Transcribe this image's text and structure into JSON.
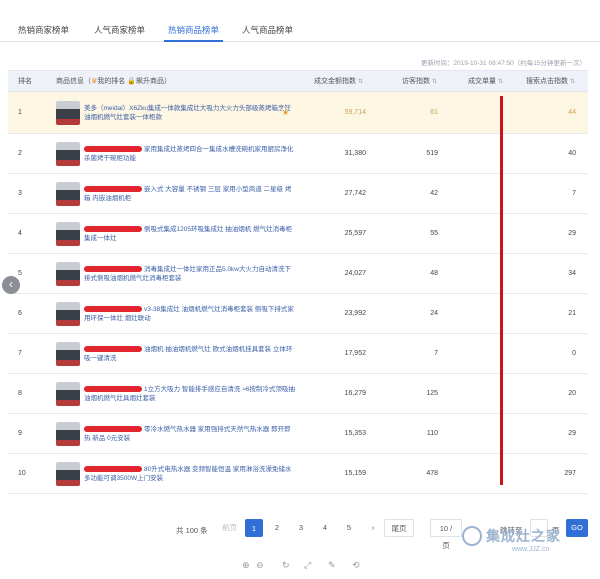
{
  "tabs": [
    {
      "label": "热销商家榜单",
      "active": false
    },
    {
      "label": "人气商家榜单",
      "active": false
    },
    {
      "label": "热销商品榜单",
      "active": true
    },
    {
      "label": "人气商品榜单",
      "active": false
    }
  ],
  "updated_text": "更新时间：2019-10-31 08:47:50（约每15分钟更新一次）",
  "columns": {
    "rank": "排名",
    "info_a": "商品信息（",
    "info_b": "我的排名",
    "info_c": "飙升商品）",
    "total": "成交金额指数",
    "visits": "访客指数",
    "sold": "成交单量",
    "search": "搜索点击指数",
    "sort_glyph": "⇅",
    "crown_glyph": "♛",
    "lock_glyph": "🔒"
  },
  "rows": [
    {
      "rank": "1",
      "name": "美多（meidal）X6Zku集成一体款集成灶大吸力大火力头部级蒸烤箱烹饪油烟机燃气灶套装一体柜款",
      "total": "59,714",
      "visits": "61",
      "search": "44",
      "highlight": true,
      "redacted": false
    },
    {
      "rank": "2",
      "name": "家用集成灶蒸烤四合一集成水槽洗碗机家用厨房净化杀菌烤干碗柜功能",
      "total": "31,380",
      "visits": "519",
      "search": "40",
      "highlight": false,
      "redacted": true
    },
    {
      "rank": "3",
      "name": "嵌入式 大容量 不锈钢 三层 家用小型商道 二星级 烤箱 内嵌油烟机柜",
      "total": "27,742",
      "visits": "42",
      "search": "7",
      "highlight": false,
      "redacted": true
    },
    {
      "rank": "4",
      "name": "侧吸式集成1205环吸集成灶 抽油烟机 燃气灶消毒柜集成一体灶",
      "total": "25,597",
      "visits": "55",
      "search": "29",
      "highlight": false,
      "redacted": true
    },
    {
      "rank": "5",
      "name": "消毒集成灶一体灶家用正品5.0kw大火力自动清洗下排式侧吸油烟机燃气灶消毒柜套装",
      "total": "24,027",
      "visits": "48",
      "search": "34",
      "highlight": false,
      "redacted": true
    },
    {
      "rank": "6",
      "name": "v3-38集成灶 油烟机燃气灶消毒柜套装 侧吸下排式家用环保一体灶 烟灶联动",
      "total": "23,992",
      "visits": "24",
      "search": "21",
      "highlight": false,
      "redacted": true
    },
    {
      "rank": "7",
      "name": "油烟机 抽油烟机燃气灶 欧式油烟机挂具套装 立体环吸一键清洗",
      "total": "17,952",
      "visits": "7",
      "search": "0",
      "highlight": false,
      "redacted": true
    },
    {
      "rank": "8",
      "name": "1立方大吸力 智能排手感应自清洗 ≈6按制冷式顶吸抽油烟机燃气灶具烟灶套装",
      "total": "16,279",
      "visits": "125",
      "search": "20",
      "highlight": false,
      "redacted": true
    },
    {
      "rank": "9",
      "name": "零冷水燃气热水器 家用强排式天然气热水器 即开即热 新品 0元安装",
      "total": "15,353",
      "visits": "110",
      "search": "29",
      "highlight": false,
      "redacted": true
    },
    {
      "rank": "10",
      "name": "80升式电热水器 变频智能恒温 家用淋浴洗澡免储水 多功能可调3500W上门安装",
      "total": "15,159",
      "visits": "478",
      "search": "297",
      "highlight": false,
      "redacted": true
    }
  ],
  "pagination": {
    "total": "共 100 条",
    "prev": "前页",
    "pages": [
      "1",
      "2",
      "3",
      "4",
      "5"
    ],
    "current": "1",
    "next_arrow": "›",
    "last": "尾页",
    "per_page": "10 / 页",
    "jump_label": "跳转至",
    "page_unit": "页",
    "go": "GO"
  },
  "nav": {
    "left_arrow": "‹"
  },
  "watermark": {
    "title": "集成灶之家",
    "url": "www.JJZ.cn"
  },
  "toolbar_icons": [
    "⊕",
    "⊖",
    "↻",
    "⤢",
    "✎",
    "⟲"
  ]
}
